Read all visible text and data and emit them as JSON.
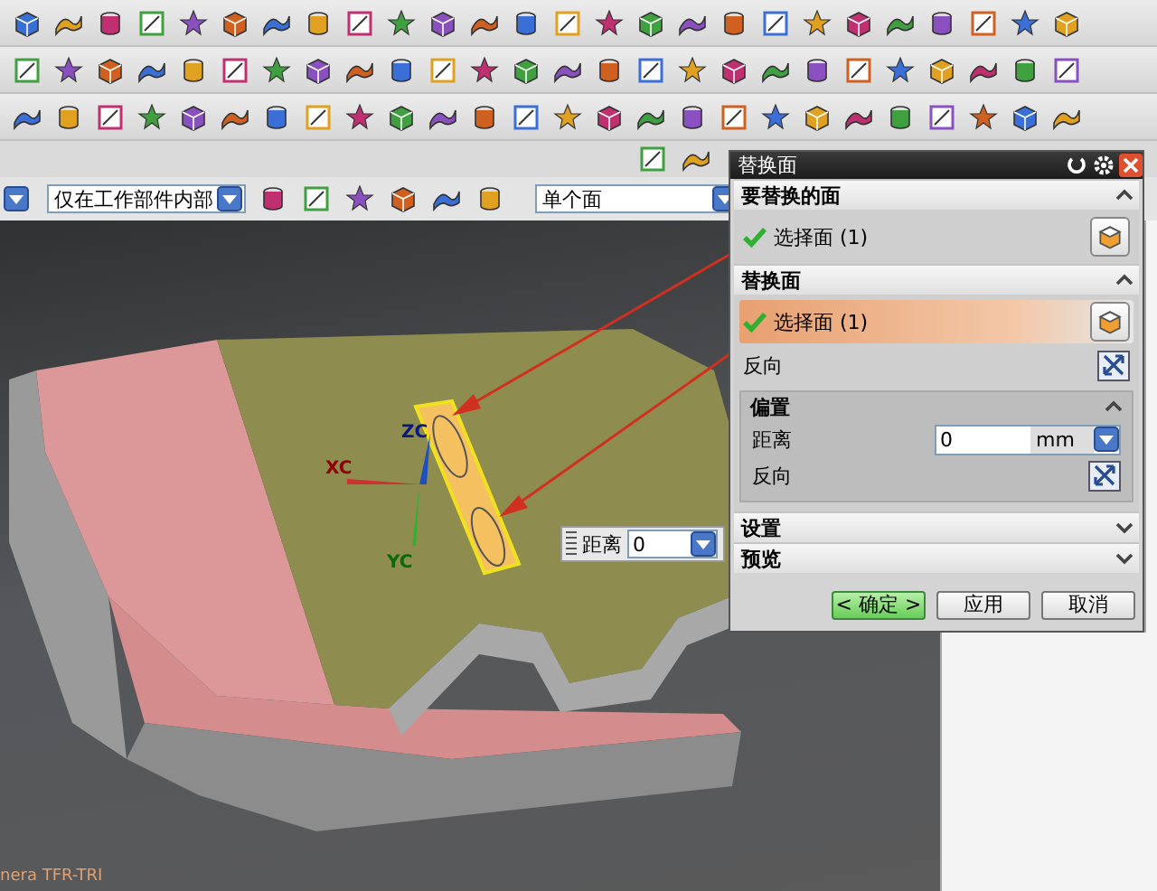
{
  "selection_bar": {
    "filter": "仅在工作部件内部",
    "face_rule": "单个面"
  },
  "viewport": {
    "axes": {
      "x": "XC",
      "y": "YC",
      "z": "ZC"
    },
    "floating_field": {
      "label": "距离",
      "value": "0"
    },
    "view_label": "nera TFR-TRI"
  },
  "dialog": {
    "title": "替换面",
    "sections": [
      {
        "title": "要替换的面",
        "expanded": true,
        "rows": [
          {
            "kind": "select",
            "label": "选择面 (1)",
            "selected": false
          }
        ]
      },
      {
        "title": "替换面",
        "expanded": true,
        "rows": [
          {
            "kind": "select",
            "label": "选择面 (1)",
            "selected": true
          },
          {
            "kind": "toggle",
            "label": "反向"
          }
        ],
        "subsection": {
          "title": "偏置",
          "expanded": true,
          "rows": [
            {
              "kind": "number",
              "label": "距离",
              "value": "0",
              "unit": "mm"
            },
            {
              "kind": "toggle",
              "label": "反向"
            }
          ]
        }
      },
      {
        "title": "设置",
        "expanded": false
      },
      {
        "title": "预览",
        "expanded": false
      }
    ],
    "buttons": [
      {
        "label": "< 确定 >",
        "default": true
      },
      {
        "label": "应用",
        "default": false
      },
      {
        "label": "取消",
        "default": false
      }
    ]
  }
}
